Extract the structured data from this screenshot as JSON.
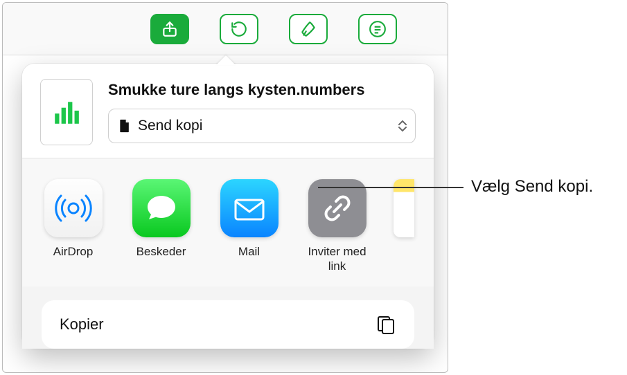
{
  "header": {
    "file_title": "Smukke ture langs kysten.numbers",
    "send_select_label": "Send kopi"
  },
  "apps": [
    {
      "label": "AirDrop",
      "icon": "airdrop-icon"
    },
    {
      "label": "Beskeder",
      "icon": "messages-icon"
    },
    {
      "label": "Mail",
      "icon": "mail-icon"
    },
    {
      "label": "Inviter med link",
      "icon": "link-icon"
    }
  ],
  "actions": {
    "copy_label": "Kopier"
  },
  "callout": {
    "text": "Vælg Send kopi."
  }
}
